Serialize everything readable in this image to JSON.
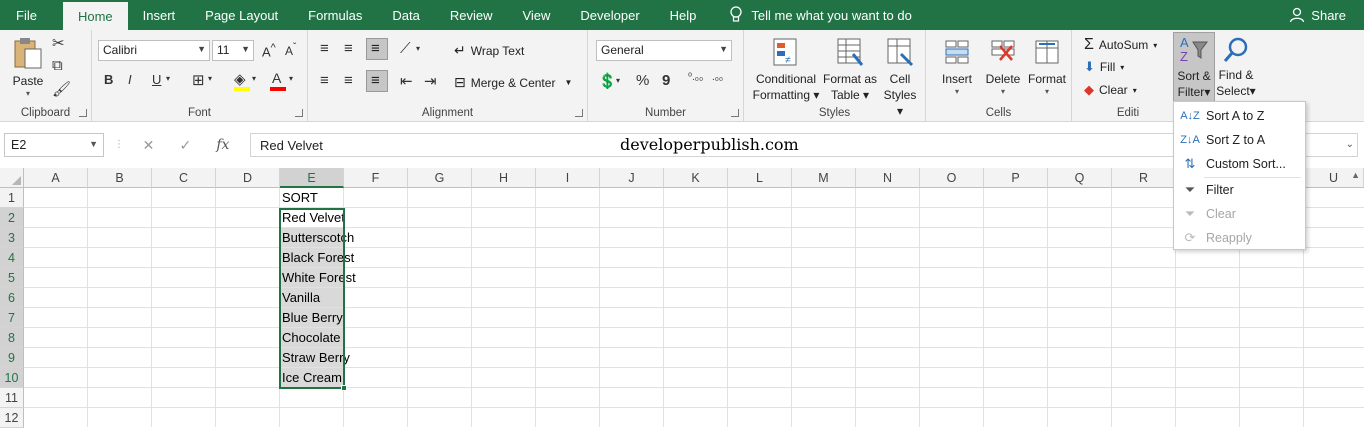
{
  "tabs": [
    "File",
    "Home",
    "Insert",
    "Page Layout",
    "Formulas",
    "Data",
    "Review",
    "View",
    "Developer",
    "Help"
  ],
  "tell_me": "Tell me what you want to do",
  "share": "Share",
  "clipboard": {
    "paste": "Paste",
    "label": "Clipboard"
  },
  "font": {
    "name": "Calibri",
    "size": "11",
    "label": "Font",
    "bold": "B",
    "italic": "I",
    "underline": "U"
  },
  "alignment": {
    "wrap_text": "Wrap Text",
    "merge_center": "Merge & Center",
    "label": "Alignment"
  },
  "number": {
    "format": "General",
    "percent": "%",
    "comma": "9",
    "label": "Number"
  },
  "styles": {
    "conditional": "Conditional",
    "formatting": "Formatting",
    "format_as": "Format as",
    "table": "Table",
    "cell": "Cell",
    "styles": "Styles",
    "label": "Styles"
  },
  "cells": {
    "insert": "Insert",
    "delete": "Delete",
    "format": "Format",
    "label": "Cells"
  },
  "editing": {
    "autosum": "AutoSum",
    "fill": "Fill",
    "clear": "Clear",
    "sort": "Sort &",
    "filter": "Filter",
    "find": "Find &",
    "select": "Select",
    "label": "Editi"
  },
  "name_box": "E2",
  "fx": "fx",
  "formula_value": "Red Velvet",
  "watermark": "developerpublish.com",
  "columns": [
    "A",
    "B",
    "C",
    "D",
    "E",
    "F",
    "G",
    "H",
    "I",
    "J",
    "K",
    "L",
    "M",
    "N",
    "O",
    "P",
    "Q",
    "R",
    "U"
  ],
  "rows": [
    "1",
    "2",
    "3",
    "4",
    "5",
    "6",
    "7",
    "8",
    "9",
    "10",
    "11",
    "12"
  ],
  "cells_e": [
    "SORT",
    "Red Velvet",
    "Butterscotch",
    "Black Forest",
    "White Forest",
    "Vanilla",
    "Blue Berry",
    "Chocolate",
    "Straw Berry",
    "Ice Cream"
  ],
  "dropdown": {
    "sort_az": "Sort A to Z",
    "sort_za": "Sort Z to A",
    "custom": "Custom Sort...",
    "filter": "Filter",
    "clear": "Clear",
    "reapply": "Reapply"
  },
  "colors": {
    "brand": "#217346",
    "ribbon": "#f3f3f3",
    "selection_fill": "#d9d9d9"
  }
}
